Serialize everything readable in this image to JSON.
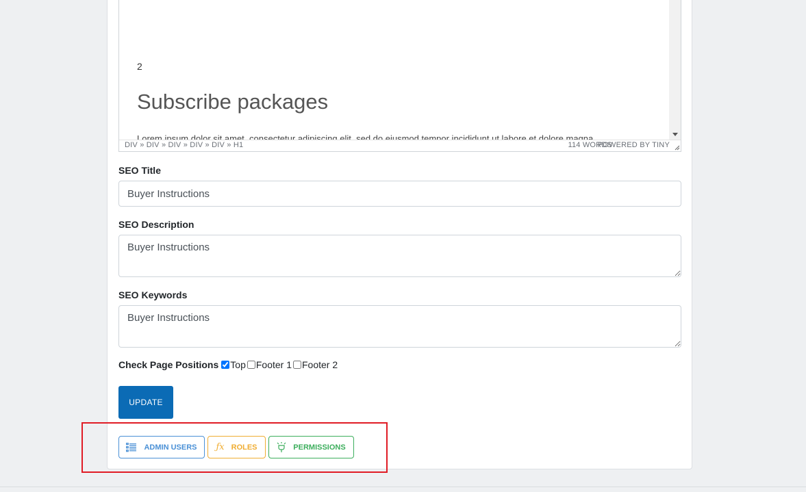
{
  "editor": {
    "number_text": "2",
    "heading": "Subscribe packages",
    "paragraph": "Lorem ipsum dolor sit amet, consectetur adipiscing elit, sed do eiusmod tempor incididunt ut labore et dolore magna",
    "status_path": "DIV » DIV » DIV » DIV » DIV » H1",
    "word_count": "114 WORDS",
    "powered_by": "POWERED BY TINY"
  },
  "seo": {
    "title_label": "SEO Title",
    "title_value": "Buyer Instructions",
    "description_label": "SEO Description",
    "description_value": "Buyer Instructions",
    "keywords_label": "SEO Keywords",
    "keywords_value": "Buyer Instructions"
  },
  "positions": {
    "label": "Check Page Positions",
    "options": [
      {
        "label": "Top",
        "checked": true
      },
      {
        "label": "Footer 1",
        "checked": false
      },
      {
        "label": "Footer 2",
        "checked": false
      }
    ]
  },
  "update_label": "UPDATE",
  "nav_buttons": [
    {
      "label": "ADMIN USERS",
      "icon": "list-icon",
      "color": "#4a90d6"
    },
    {
      "label": "ROLES",
      "icon": "function-icon",
      "color": "#f0ad32"
    },
    {
      "label": "PERMISSIONS",
      "icon": "plug-icon",
      "color": "#3cae5c"
    }
  ],
  "colors": {
    "primary": "#0b6bb5",
    "highlight_box": "#e01b24"
  }
}
